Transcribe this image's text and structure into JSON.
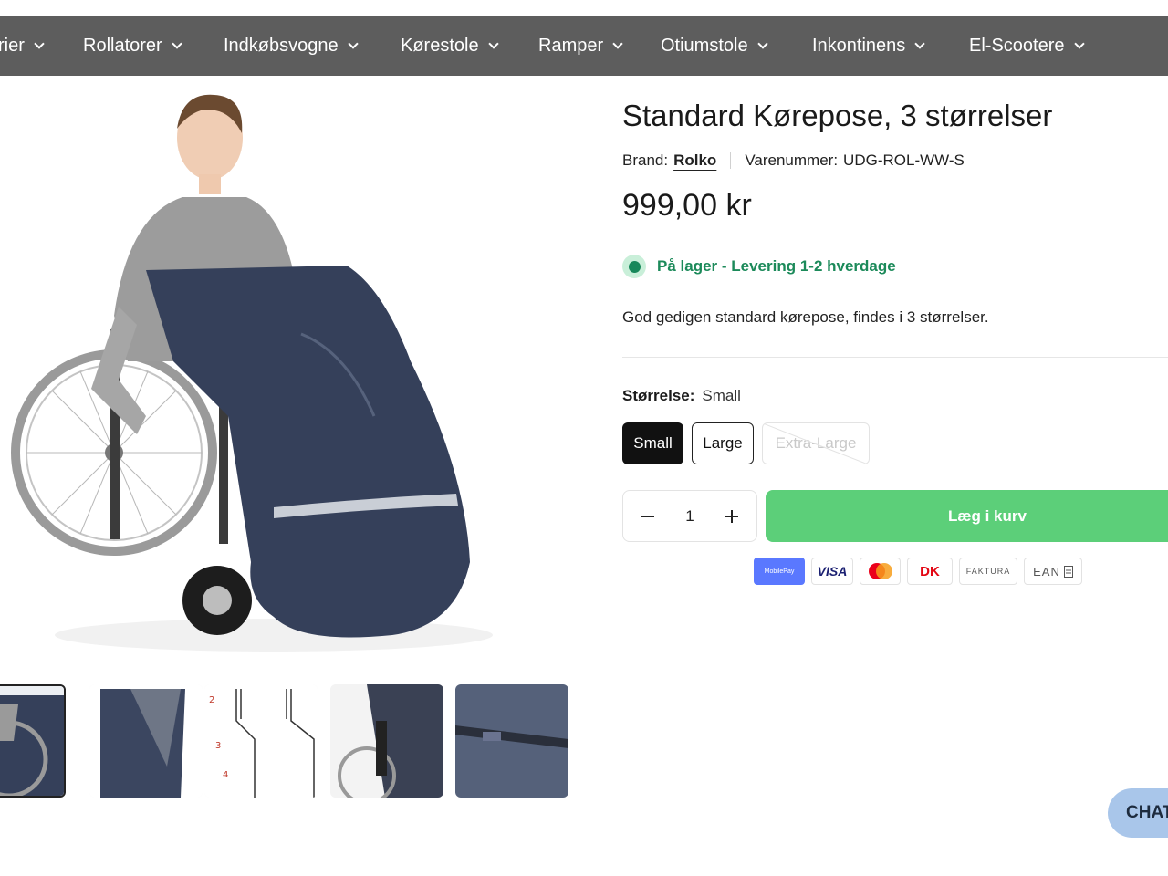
{
  "nav": {
    "items": [
      {
        "label": "rier",
        "icon": "chevron-down-icon"
      },
      {
        "label": "Rollatorer",
        "icon": "chevron-down-icon"
      },
      {
        "label": "Indkøbsvogne",
        "icon": "chevron-down-icon"
      },
      {
        "label": "Kørestole",
        "icon": "chevron-down-icon"
      },
      {
        "label": "Ramper",
        "icon": "chevron-down-icon"
      },
      {
        "label": "Otiumstole",
        "icon": "chevron-down-icon"
      },
      {
        "label": "Inkontinens",
        "icon": "chevron-down-icon"
      },
      {
        "label": "El-Scootere",
        "icon": "chevron-down-icon"
      }
    ],
    "background": "#5d5d5d"
  },
  "product": {
    "title": "Standard Kørepose, 3 størrelser",
    "brand_label": "Brand:",
    "brand": "Rolko",
    "sku_label": "Varenummer:",
    "sku": "UDG-ROL-WW-S",
    "price": "999,00 kr",
    "stock": "På lager - Levering 1-2 hverdage",
    "description": "God gedigen standard kørepose, findes i 3 størrelser."
  },
  "size": {
    "label": "Størrelse:",
    "selected": "Small",
    "options": [
      "Small",
      "Large",
      "Extra-Large"
    ]
  },
  "quantity": {
    "value": "1",
    "minus_icon": "minus-icon",
    "plus_icon": "plus-icon"
  },
  "cart": {
    "button_label": "Læg i kurv",
    "color": "#5ccf79"
  },
  "payments": {
    "mobilepay": "MobilePay",
    "visa": "VISA",
    "mastercard": "mastercard",
    "dankort": "DK",
    "faktura": "FAKTURA",
    "ean": "EAN"
  },
  "chat": {
    "label": "CHAT"
  },
  "colors": {
    "stock_green": "#1c8a5a",
    "selected_size": "#111111"
  }
}
